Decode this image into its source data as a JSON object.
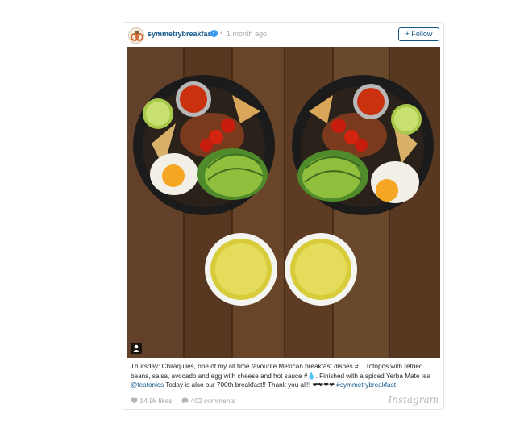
{
  "post": {
    "username": "symmetrybreakfast",
    "verified_icon": "✓",
    "separator": "•",
    "time": "1 month ago",
    "follow_label": "+ Follow",
    "caption": {
      "text_1": "Thursday: Chilaquiles, one of my all time favourite Mexican breakfast dishes #  Totopos with refried beans, salsa, avocado and egg with cheese and hot sauce #💧. Finished with a spiced Yerba Mate tea ",
      "mention": "@teatonics",
      "text_2": " Today is also our 700th breakfast!! Thank you all!! ❤❤❤❤ ",
      "hashtag": "#symmetrybreakfast"
    },
    "likes": "14.9k likes",
    "comments": "402 comments",
    "brand": "Instagram"
  },
  "colors": {
    "link": "#125688",
    "meta": "#a5a7aa",
    "wood": "#5a3a22"
  }
}
